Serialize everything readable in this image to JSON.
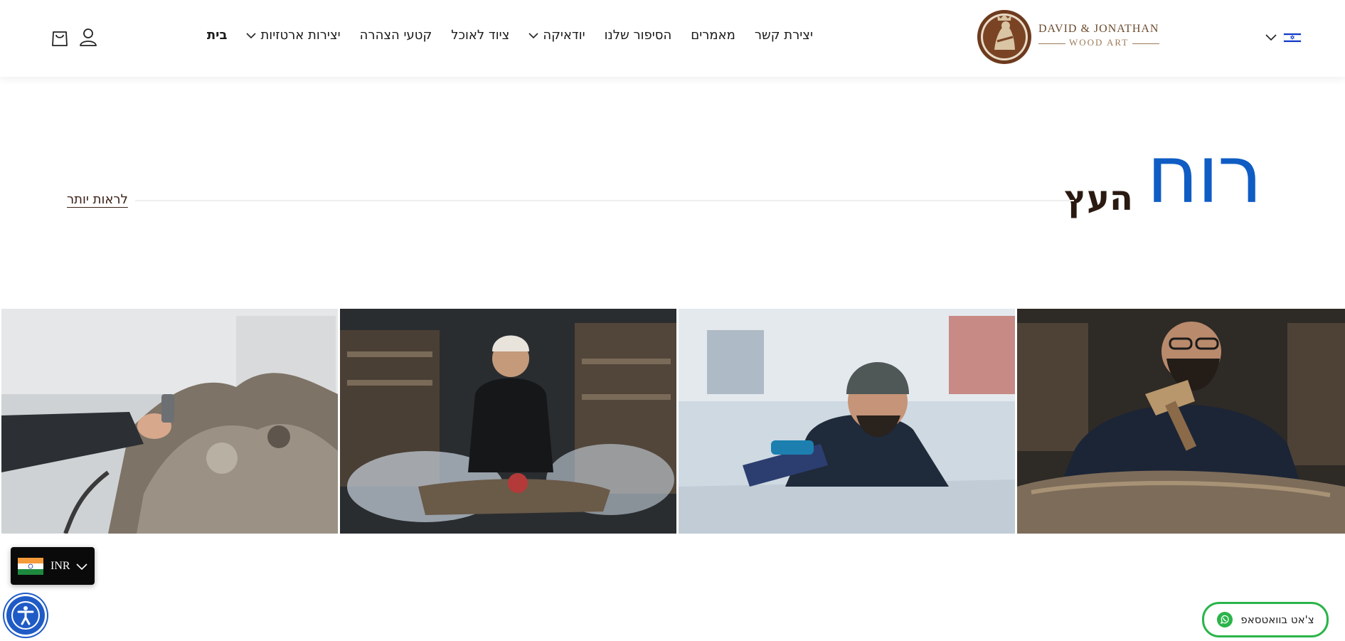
{
  "header": {
    "nav": [
      {
        "label": "בית",
        "active": true,
        "dropdown": false
      },
      {
        "label": "יצירות ארטזיות",
        "active": false,
        "dropdown": true
      },
      {
        "label": "קטעי הצהרה",
        "active": false,
        "dropdown": false
      },
      {
        "label": "ציוד לאוכל",
        "active": false,
        "dropdown": false
      },
      {
        "label": "יודאיקה",
        "active": false,
        "dropdown": true
      },
      {
        "label": "הסיפור שלנו",
        "active": false,
        "dropdown": false
      },
      {
        "label": "מאמרים",
        "active": false,
        "dropdown": false
      },
      {
        "label": "יצירת קשר",
        "active": false,
        "dropdown": false
      }
    ],
    "logo": {
      "line1": "DAVID & JONATHAN",
      "line2": "WOOD ART"
    },
    "icons": {
      "cart": "shopping-bag-icon",
      "account": "user-icon",
      "language": "israel-flag-icon"
    }
  },
  "hero": {
    "title": "רוח",
    "subtitle": "העץ",
    "see_more": "לראות יותר",
    "title_color": "#0f5dc4"
  },
  "gallery": {
    "photos": [
      "workshop-sanding-photo",
      "workshop-grinding-photo",
      "workshop-planing-photo",
      "workshop-chiseling-photo"
    ]
  },
  "currency": {
    "code": "INR"
  },
  "whatsapp": {
    "label": "צ'אט בוואטסאפ",
    "color": "#2bb44a"
  },
  "accessibility": {
    "color": "#1f5bc6"
  }
}
